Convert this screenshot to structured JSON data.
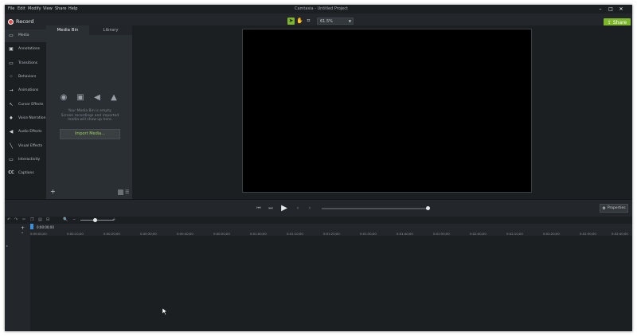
{
  "menu": [
    "File",
    "Edit",
    "Modify",
    "View",
    "Share",
    "Help"
  ],
  "app_title": "Camtasia - Untitled Project",
  "window_controls": {
    "minimize": "–",
    "maximize": "□",
    "close": "✕"
  },
  "toolbar": {
    "record_label": "Record",
    "tools": {
      "select": "➤",
      "pan": "✋",
      "crop": "⌗"
    },
    "zoom_value": "61.5%",
    "share_label": "Share"
  },
  "sidebar": {
    "items": [
      {
        "label": "Media",
        "icon": "media-icon",
        "glyph": "▭"
      },
      {
        "label": "Annotations",
        "icon": "annotation-icon",
        "glyph": "▣"
      },
      {
        "label": "Transitions",
        "icon": "transitions-icon",
        "glyph": "▭"
      },
      {
        "label": "Behaviors",
        "icon": "behaviors-icon",
        "glyph": "⁘"
      },
      {
        "label": "Animations",
        "icon": "animations-icon",
        "glyph": "→"
      },
      {
        "label": "Cursor Effects",
        "icon": "cursor-effects-icon",
        "glyph": "↖"
      },
      {
        "label": "Voice Narration",
        "icon": "microphone-icon",
        "glyph": "♦"
      },
      {
        "label": "Audio Effects",
        "icon": "speaker-icon",
        "glyph": "◀"
      },
      {
        "label": "Visual Effects",
        "icon": "wand-icon",
        "glyph": "╲"
      },
      {
        "label": "Interactivity",
        "icon": "interactivity-icon",
        "glyph": "▭"
      },
      {
        "label": "Captions",
        "icon": "captions-icon",
        "glyph": "CC"
      }
    ]
  },
  "media_bin": {
    "tab_media_bin": "Media Bin",
    "tab_library": "Library",
    "empty_line1": "Your Media Bin is empty.",
    "empty_line2": "Screen recordings and imported",
    "empty_line3": "media will show up here.",
    "import_label": "Import Media...",
    "add_glyph": "+",
    "list_glyph": "☰"
  },
  "playback": {
    "prev": "⏮",
    "back": "⏭",
    "play": "▶",
    "step_back": "‹",
    "step_fwd": "›"
  },
  "properties_label": "Properties",
  "timeline_tools": {
    "undo": "↶",
    "redo": "↷",
    "cut": "✂",
    "copy": "❐",
    "paste": "▤",
    "split": "⊟",
    "zoom_in_icon": "🔍",
    "minus": "−",
    "plus": "+"
  },
  "track_head": {
    "add": "+",
    "collapse": "⌄",
    "track": "▸"
  },
  "timeline": {
    "playhead_time": "0:00:00;00",
    "ticks": [
      "0:00:00;00",
      "0:00:10;00",
      "0:00:20;00",
      "0:00:30;00",
      "0:00:40;00",
      "0:00:50;00",
      "0:01:00;00",
      "0:01:10;00",
      "0:01:20;00",
      "0:01:30;00",
      "0:01:40;00",
      "0:01:50;00",
      "0:02:00;00",
      "0:02:10;00",
      "0:02:20;00",
      "0:02:30;00",
      "0:02:40;00"
    ]
  },
  "colors": {
    "accent": "#7db52b",
    "record": "#e84b4b",
    "playhead": "#3c8fd8",
    "background": "#1c1f22"
  }
}
